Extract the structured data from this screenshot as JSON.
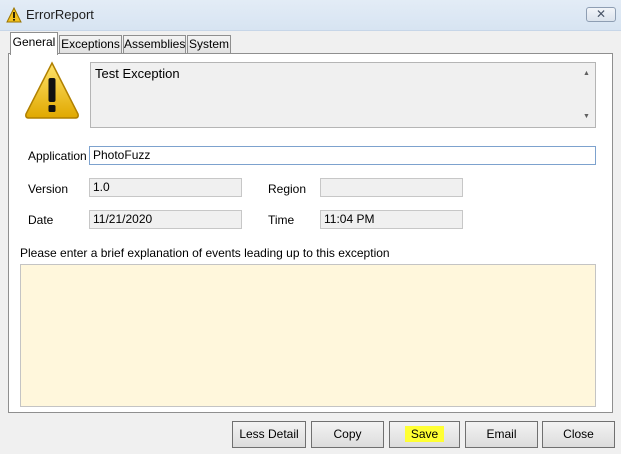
{
  "window": {
    "title": "ErrorReport",
    "close_symbol": "✕"
  },
  "tabs": [
    {
      "label": "General",
      "active": true
    },
    {
      "label": "Exceptions",
      "active": false
    },
    {
      "label": "Assemblies",
      "active": false
    },
    {
      "label": "System",
      "active": false
    }
  ],
  "general": {
    "message": "Test Exception",
    "application_label": "Application",
    "application_value": "PhotoFuzz",
    "version_label": "Version",
    "version_value": "1.0",
    "region_label": "Region",
    "region_value": "",
    "date_label": "Date",
    "date_value": "11/21/2020",
    "time_label": "Time",
    "time_value": "11:04 PM",
    "explanation_prompt": "Please enter a brief explanation of events leading up to this exception",
    "explanation_value": ""
  },
  "buttons": {
    "less_detail": "Less Detail",
    "copy": "Copy",
    "save": "Save",
    "email": "Email",
    "close": "Close"
  },
  "colors": {
    "notes_background": "#fff7dc",
    "save_highlight": "#ffff33",
    "warning_fill": "#f2c200"
  },
  "icons": {
    "title": "warning-icon",
    "message": "warning-icon"
  }
}
